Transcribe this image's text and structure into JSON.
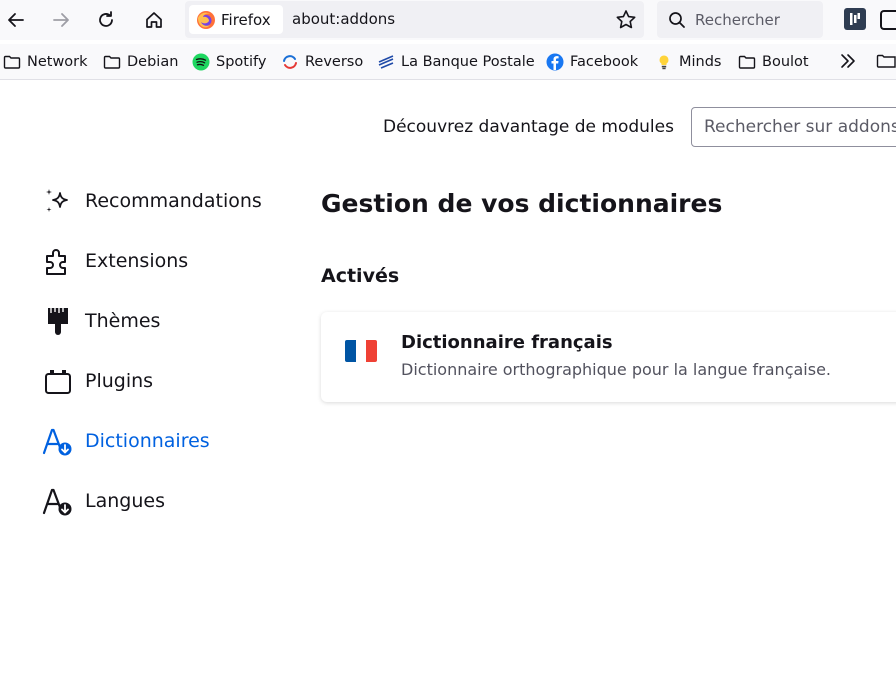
{
  "toolbar": {
    "identity_label": "Firefox",
    "url": "about:addons",
    "search_placeholder": "Rechercher"
  },
  "bookmarks": [
    {
      "label": "Network",
      "icon": "folder-icon"
    },
    {
      "label": "Debian",
      "icon": "folder-icon"
    },
    {
      "label": "Spotify",
      "icon": "spotify-icon"
    },
    {
      "label": "Reverso",
      "icon": "reverso-icon"
    },
    {
      "label": "La Banque Postale",
      "icon": "banque-postale-icon"
    },
    {
      "label": "Facebook",
      "icon": "facebook-icon"
    },
    {
      "label": "Minds",
      "icon": "lightbulb-icon"
    },
    {
      "label": "Boulot",
      "icon": "folder-icon"
    }
  ],
  "header": {
    "discover_label": "Découvrez davantage de modules",
    "search_placeholder": "Rechercher sur addons.mozilla.org"
  },
  "categories": [
    {
      "label": "Recommandations",
      "icon": "sparkle-icon"
    },
    {
      "label": "Extensions",
      "icon": "puzzle-icon"
    },
    {
      "label": "Thèmes",
      "icon": "brush-icon"
    },
    {
      "label": "Plugins",
      "icon": "plugin-icon"
    },
    {
      "label": "Dictionnaires",
      "icon": "dictionary-icon",
      "selected": true
    },
    {
      "label": "Langues",
      "icon": "language-icon"
    }
  ],
  "main": {
    "title": "Gestion de vos dictionnaires",
    "section": "Activés",
    "addons": [
      {
        "name": "Dictionnaire français",
        "description": "Dictionnaire orthographique pour la langue française.",
        "icon": "flag-france-icon"
      }
    ]
  },
  "colors": {
    "accent": "#0061e0",
    "text": "#15141a",
    "secondary_text": "#52525e",
    "flag_blue": "#0055a4",
    "flag_white": "#ffffff",
    "flag_red": "#ef4135"
  }
}
